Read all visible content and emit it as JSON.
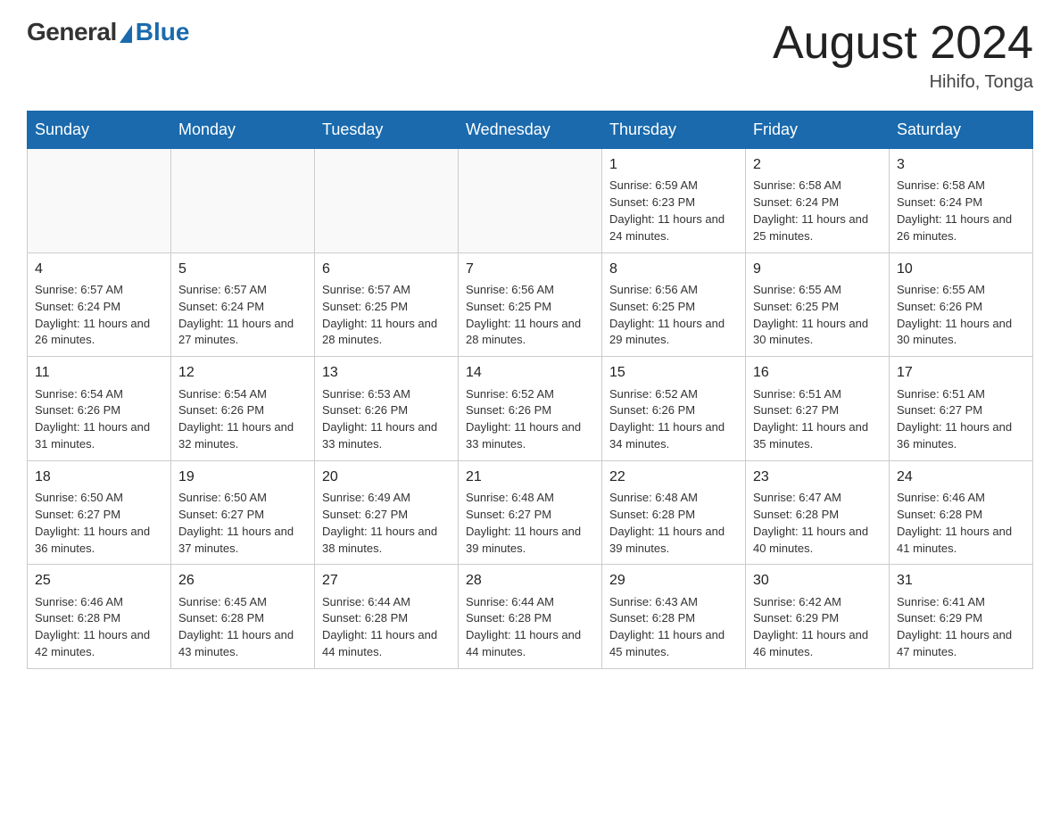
{
  "header": {
    "logo_general": "General",
    "logo_blue": "Blue",
    "month_title": "August 2024",
    "location": "Hihifo, Tonga"
  },
  "days_of_week": [
    "Sunday",
    "Monday",
    "Tuesday",
    "Wednesday",
    "Thursday",
    "Friday",
    "Saturday"
  ],
  "weeks": [
    [
      {
        "day": "",
        "info": ""
      },
      {
        "day": "",
        "info": ""
      },
      {
        "day": "",
        "info": ""
      },
      {
        "day": "",
        "info": ""
      },
      {
        "day": "1",
        "info": "Sunrise: 6:59 AM\nSunset: 6:23 PM\nDaylight: 11 hours and 24 minutes."
      },
      {
        "day": "2",
        "info": "Sunrise: 6:58 AM\nSunset: 6:24 PM\nDaylight: 11 hours and 25 minutes."
      },
      {
        "day": "3",
        "info": "Sunrise: 6:58 AM\nSunset: 6:24 PM\nDaylight: 11 hours and 26 minutes."
      }
    ],
    [
      {
        "day": "4",
        "info": "Sunrise: 6:57 AM\nSunset: 6:24 PM\nDaylight: 11 hours and 26 minutes."
      },
      {
        "day": "5",
        "info": "Sunrise: 6:57 AM\nSunset: 6:24 PM\nDaylight: 11 hours and 27 minutes."
      },
      {
        "day": "6",
        "info": "Sunrise: 6:57 AM\nSunset: 6:25 PM\nDaylight: 11 hours and 28 minutes."
      },
      {
        "day": "7",
        "info": "Sunrise: 6:56 AM\nSunset: 6:25 PM\nDaylight: 11 hours and 28 minutes."
      },
      {
        "day": "8",
        "info": "Sunrise: 6:56 AM\nSunset: 6:25 PM\nDaylight: 11 hours and 29 minutes."
      },
      {
        "day": "9",
        "info": "Sunrise: 6:55 AM\nSunset: 6:25 PM\nDaylight: 11 hours and 30 minutes."
      },
      {
        "day": "10",
        "info": "Sunrise: 6:55 AM\nSunset: 6:26 PM\nDaylight: 11 hours and 30 minutes."
      }
    ],
    [
      {
        "day": "11",
        "info": "Sunrise: 6:54 AM\nSunset: 6:26 PM\nDaylight: 11 hours and 31 minutes."
      },
      {
        "day": "12",
        "info": "Sunrise: 6:54 AM\nSunset: 6:26 PM\nDaylight: 11 hours and 32 minutes."
      },
      {
        "day": "13",
        "info": "Sunrise: 6:53 AM\nSunset: 6:26 PM\nDaylight: 11 hours and 33 minutes."
      },
      {
        "day": "14",
        "info": "Sunrise: 6:52 AM\nSunset: 6:26 PM\nDaylight: 11 hours and 33 minutes."
      },
      {
        "day": "15",
        "info": "Sunrise: 6:52 AM\nSunset: 6:26 PM\nDaylight: 11 hours and 34 minutes."
      },
      {
        "day": "16",
        "info": "Sunrise: 6:51 AM\nSunset: 6:27 PM\nDaylight: 11 hours and 35 minutes."
      },
      {
        "day": "17",
        "info": "Sunrise: 6:51 AM\nSunset: 6:27 PM\nDaylight: 11 hours and 36 minutes."
      }
    ],
    [
      {
        "day": "18",
        "info": "Sunrise: 6:50 AM\nSunset: 6:27 PM\nDaylight: 11 hours and 36 minutes."
      },
      {
        "day": "19",
        "info": "Sunrise: 6:50 AM\nSunset: 6:27 PM\nDaylight: 11 hours and 37 minutes."
      },
      {
        "day": "20",
        "info": "Sunrise: 6:49 AM\nSunset: 6:27 PM\nDaylight: 11 hours and 38 minutes."
      },
      {
        "day": "21",
        "info": "Sunrise: 6:48 AM\nSunset: 6:27 PM\nDaylight: 11 hours and 39 minutes."
      },
      {
        "day": "22",
        "info": "Sunrise: 6:48 AM\nSunset: 6:28 PM\nDaylight: 11 hours and 39 minutes."
      },
      {
        "day": "23",
        "info": "Sunrise: 6:47 AM\nSunset: 6:28 PM\nDaylight: 11 hours and 40 minutes."
      },
      {
        "day": "24",
        "info": "Sunrise: 6:46 AM\nSunset: 6:28 PM\nDaylight: 11 hours and 41 minutes."
      }
    ],
    [
      {
        "day": "25",
        "info": "Sunrise: 6:46 AM\nSunset: 6:28 PM\nDaylight: 11 hours and 42 minutes."
      },
      {
        "day": "26",
        "info": "Sunrise: 6:45 AM\nSunset: 6:28 PM\nDaylight: 11 hours and 43 minutes."
      },
      {
        "day": "27",
        "info": "Sunrise: 6:44 AM\nSunset: 6:28 PM\nDaylight: 11 hours and 44 minutes."
      },
      {
        "day": "28",
        "info": "Sunrise: 6:44 AM\nSunset: 6:28 PM\nDaylight: 11 hours and 44 minutes."
      },
      {
        "day": "29",
        "info": "Sunrise: 6:43 AM\nSunset: 6:28 PM\nDaylight: 11 hours and 45 minutes."
      },
      {
        "day": "30",
        "info": "Sunrise: 6:42 AM\nSunset: 6:29 PM\nDaylight: 11 hours and 46 minutes."
      },
      {
        "day": "31",
        "info": "Sunrise: 6:41 AM\nSunset: 6:29 PM\nDaylight: 11 hours and 47 minutes."
      }
    ]
  ]
}
